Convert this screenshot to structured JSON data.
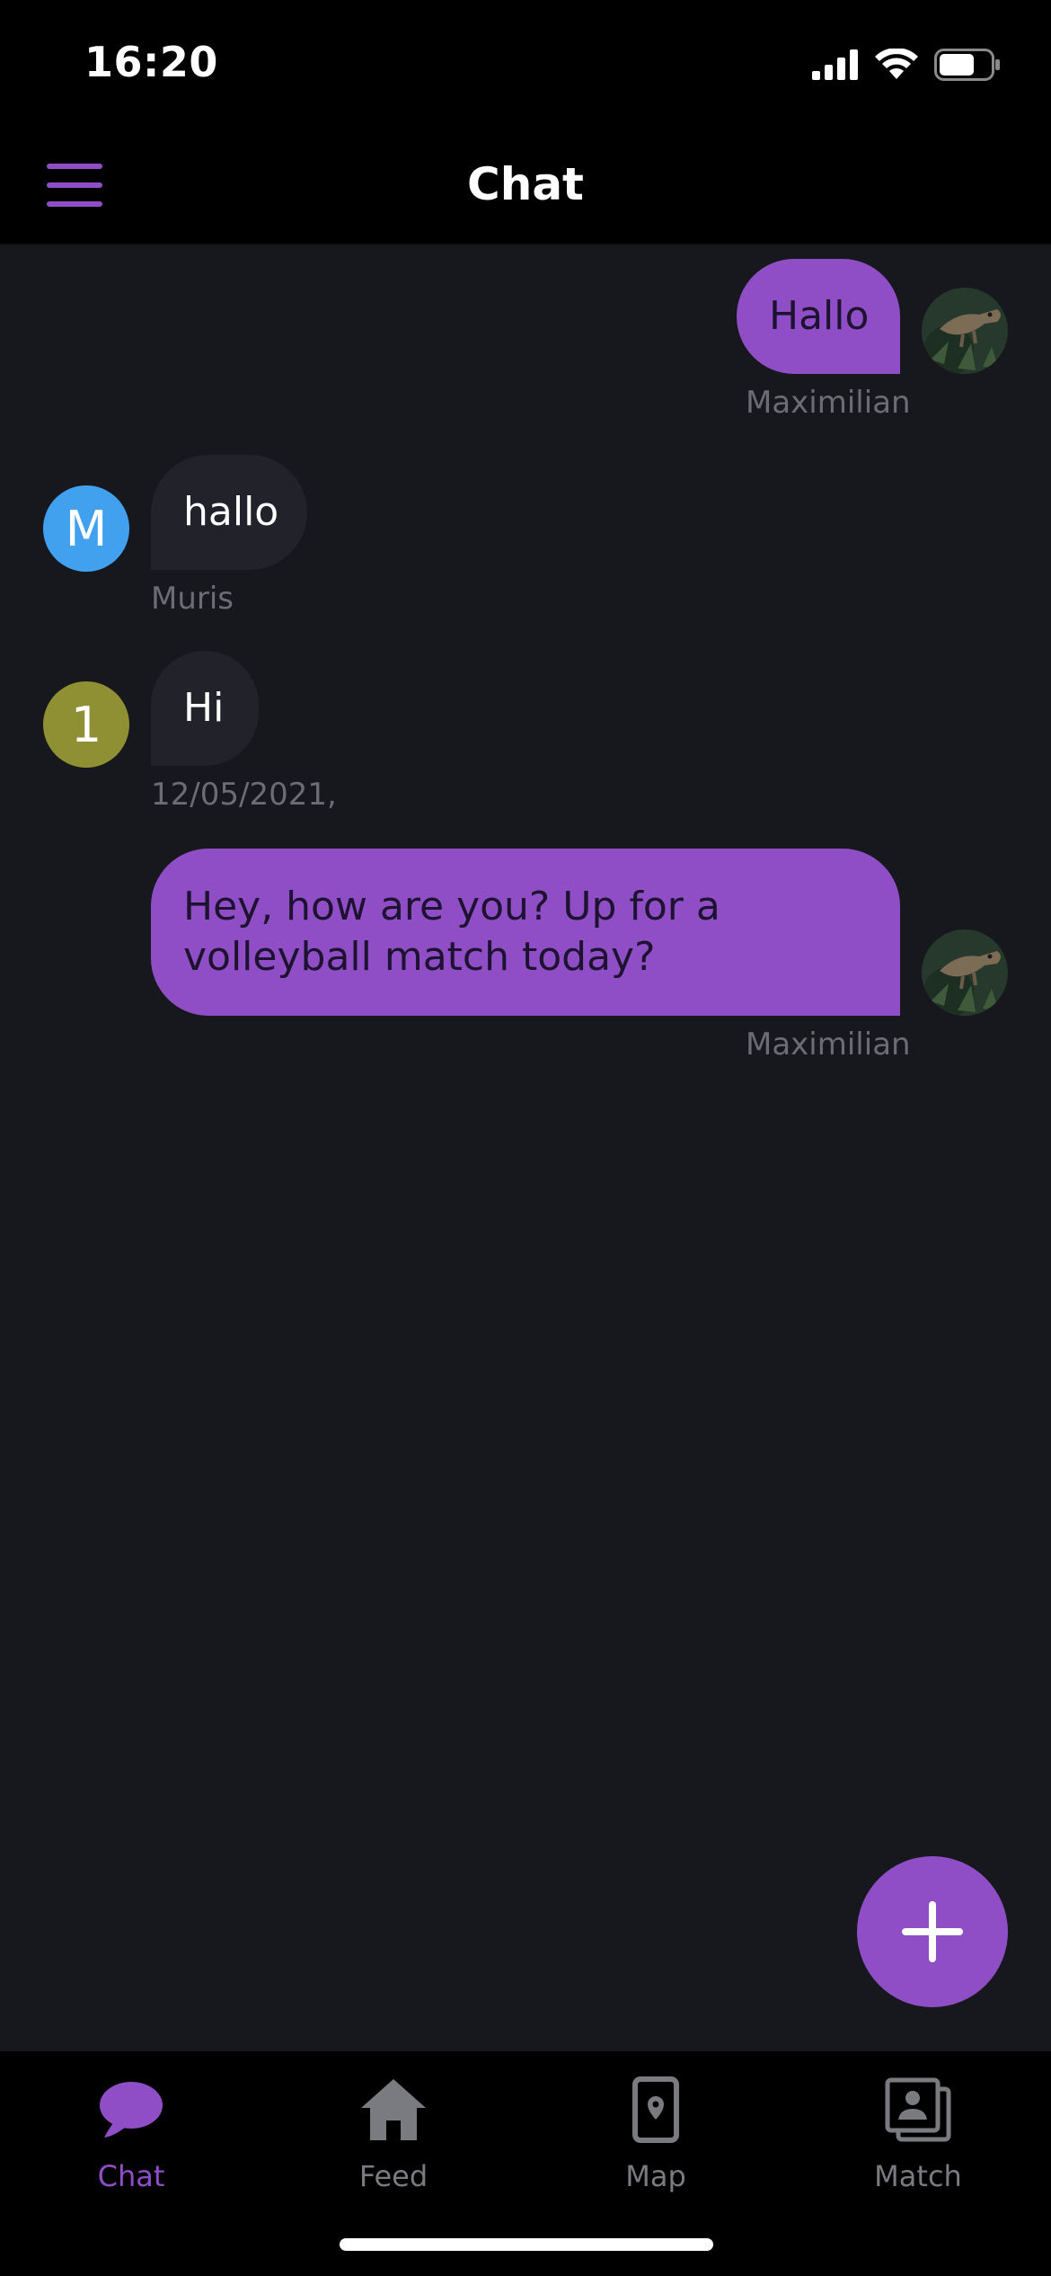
{
  "status": {
    "time": "16:20"
  },
  "header": {
    "title": "Chat"
  },
  "messages": [
    {
      "text": "Hallo",
      "sender": "Maximilian",
      "avatar_letter": ""
    },
    {
      "text": "hallo",
      "sender": "Muris",
      "avatar_letter": "M"
    },
    {
      "text": "Hi",
      "sender": "12/05/2021,",
      "avatar_letter": "1"
    },
    {
      "text": "Hey, how are you? Up for a volleyball match today?",
      "sender": "Maximilian",
      "avatar_letter": ""
    }
  ],
  "fab": {
    "icon": "plus-icon"
  },
  "nav": {
    "items": [
      {
        "label": "Chat",
        "icon": "chat-bubble-icon"
      },
      {
        "label": "Feed",
        "icon": "home-icon"
      },
      {
        "label": "Map",
        "icon": "map-phone-pin-icon"
      },
      {
        "label": "Match",
        "icon": "match-cards-icon"
      }
    ]
  },
  "colors": {
    "accent": "#8f4ec6",
    "background": "#17181d",
    "incoming_bubble": "#21222a",
    "avatar_muris": "#42a1ef",
    "avatar_one": "#8f8f33"
  }
}
